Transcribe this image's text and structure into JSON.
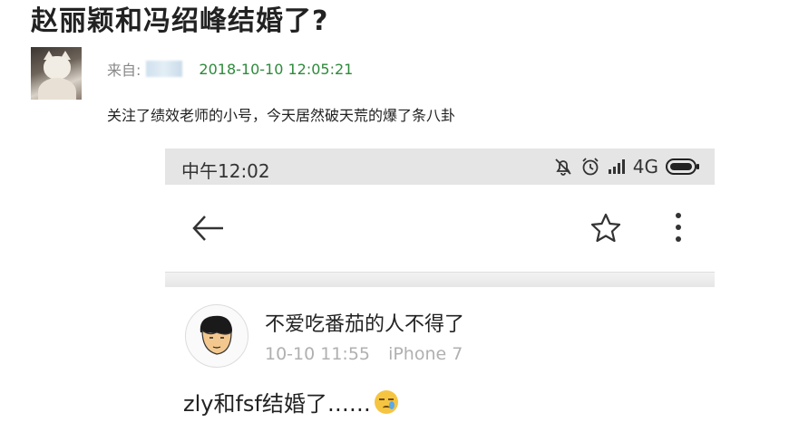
{
  "post": {
    "title": "赵丽颖和冯绍峰结婚了?",
    "from_label": "来自:",
    "timestamp": "2018-10-10 12:05:21",
    "body": "关注了绩效老师的小号，今天居然破天荒的爆了条八卦"
  },
  "phone": {
    "status_time": "中午12:02",
    "network": "4G",
    "icons": [
      "mute-bell-icon",
      "alarm-icon",
      "signal-icon",
      "battery-icon"
    ],
    "app_bar_icons": [
      "back-arrow-icon",
      "star-icon",
      "more-vertical-icon"
    ],
    "weibo": {
      "username": "不爱吃番茄的人不得了",
      "time": "10-10 11:55",
      "device": "iPhone 7",
      "text": "zly和fsf结婚了……",
      "emoji": "sweat-emoji"
    }
  },
  "colors": {
    "timestamp_green": "#2d8a3a",
    "status_bar_bg": "#e5e5e5",
    "meta_gray": "#b0b0b0"
  }
}
